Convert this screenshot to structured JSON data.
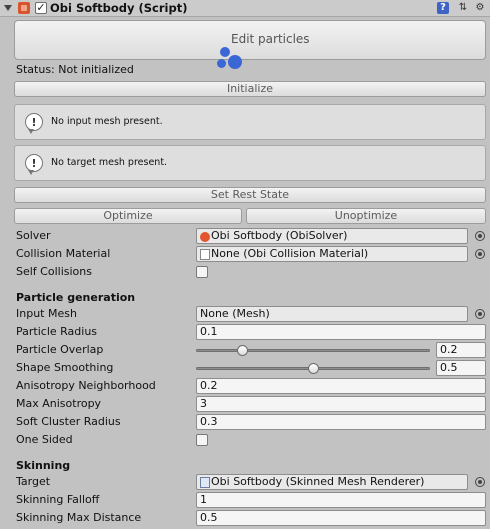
{
  "component": {
    "title": "Obi Softbody (Script)",
    "enabled": true
  },
  "edit_particles_label": "Edit particles",
  "status_label": "Status: Not initialized",
  "buttons": {
    "initialize": "Initialize",
    "set_rest_state": "Set Rest State",
    "optimize": "Optimize",
    "unoptimize": "Unoptimize"
  },
  "help": {
    "input_mesh": "No input mesh present.",
    "target_mesh": "No target mesh present."
  },
  "fields": {
    "solver": {
      "label": "Solver",
      "value": "Obi Softbody (ObiSolver)"
    },
    "collision_material": {
      "label": "Collision Material",
      "value": "None (Obi Collision Material)"
    },
    "self_collisions": {
      "label": "Self Collisions",
      "checked": false
    }
  },
  "particle_generation": {
    "header": "Particle generation",
    "input_mesh": {
      "label": "Input Mesh",
      "value": "None (Mesh)"
    },
    "particle_radius": {
      "label": "Particle Radius",
      "value": "0.1"
    },
    "particle_overlap": {
      "label": "Particle Overlap",
      "value": "0.2",
      "fraction": 0.2
    },
    "shape_smoothing": {
      "label": "Shape Smoothing",
      "value": "0.5",
      "fraction": 0.5
    },
    "anisotropy_neighborhood": {
      "label": "Anisotropy Neighborhood",
      "value": "0.2"
    },
    "max_anisotropy": {
      "label": "Max Anisotropy",
      "value": "3"
    },
    "soft_cluster_radius": {
      "label": "Soft Cluster Radius",
      "value": "0.3"
    },
    "one_sided": {
      "label": "One Sided",
      "checked": false
    }
  },
  "skinning": {
    "header": "Skinning",
    "target": {
      "label": "Target",
      "value": "Obi Softbody (Skinned Mesh Renderer)"
    },
    "falloff": {
      "label": "Skinning Falloff",
      "value": "1"
    },
    "max_distance": {
      "label": "Skinning Max Distance",
      "value": "0.5"
    }
  },
  "colors": {
    "panel_bg": "#c2c2c2",
    "accent_blue": "#3b66d6",
    "component_icon": "#d9532b"
  }
}
